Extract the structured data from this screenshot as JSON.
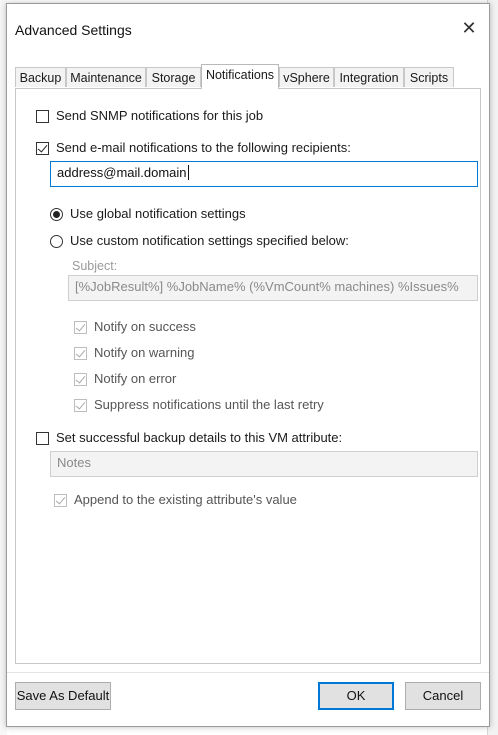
{
  "dialog": {
    "title": "Advanced Settings",
    "close_glyph": "✕"
  },
  "tabs": [
    {
      "label": "Backup",
      "active": false
    },
    {
      "label": "Maintenance",
      "active": false
    },
    {
      "label": "Storage",
      "active": false
    },
    {
      "label": "Notifications",
      "active": true
    },
    {
      "label": "vSphere",
      "active": false
    },
    {
      "label": "Integration",
      "active": false
    },
    {
      "label": "Scripts",
      "active": false
    }
  ],
  "notifications": {
    "snmp": {
      "label": "Send SNMP notifications for this job",
      "checked": false
    },
    "email": {
      "label": "Send e-mail notifications to the following recipients:",
      "checked": true
    },
    "recipients": {
      "value": "address@mail.domain"
    },
    "use_global": {
      "label": "Use global notification settings",
      "selected": true
    },
    "use_custom": {
      "label": "Use custom notification settings specified below:",
      "selected": false
    },
    "subject_label": "Subject:",
    "subject_value": "[%JobResult%] %JobName% (%VmCount% machines) %Issues%",
    "notify_success": {
      "label": "Notify on success",
      "checked": true
    },
    "notify_warning": {
      "label": "Notify on warning",
      "checked": true
    },
    "notify_error": {
      "label": "Notify on error",
      "checked": true
    },
    "suppress": {
      "label": "Suppress notifications until the last retry",
      "checked": true
    },
    "vm_attribute": {
      "label": "Set successful backup details to this VM attribute:",
      "checked": false
    },
    "attribute_value": "Notes",
    "append": {
      "label": "Append to the existing attribute's value",
      "checked": true
    }
  },
  "footer": {
    "save_default": "Save As Default",
    "ok": "OK",
    "cancel": "Cancel"
  }
}
